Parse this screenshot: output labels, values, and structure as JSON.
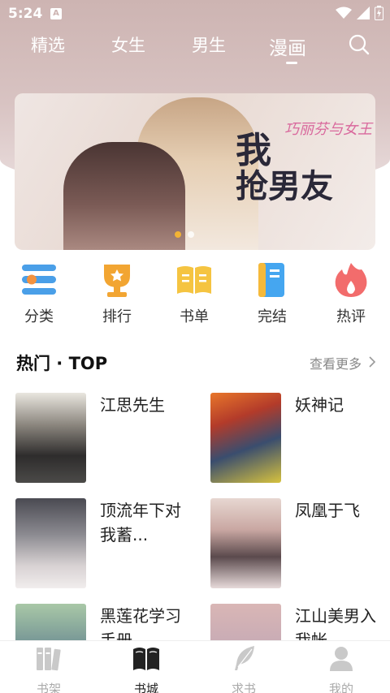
{
  "status_bar": {
    "time": "5:24",
    "notification_letter": "A"
  },
  "top_nav": {
    "tabs": [
      {
        "label": "精选"
      },
      {
        "label": "女生"
      },
      {
        "label": "男生"
      },
      {
        "label": "漫画"
      }
    ],
    "active_tab": "漫画"
  },
  "banner": {
    "title_line1": "我",
    "title_small": "巧丽芬与女王",
    "title_line2": "抢男友",
    "slide_count": 2,
    "active_slide": 1
  },
  "categories": [
    {
      "label": "分类",
      "icon": "classify-icon",
      "color": "#4a9fe8"
    },
    {
      "label": "排行",
      "icon": "trophy-icon",
      "color": "#f2a532"
    },
    {
      "label": "书单",
      "icon": "booklist-icon",
      "color": "#f5c441"
    },
    {
      "label": "完结",
      "icon": "finished-book-icon",
      "color": "#45a6f0"
    },
    {
      "label": "热评",
      "icon": "flame-icon",
      "color": "#f26c6c"
    }
  ],
  "hot_section": {
    "title": "热门 · TOP",
    "more_label": "查看更多"
  },
  "books": [
    {
      "title": "江思先生"
    },
    {
      "title": "妖神记"
    },
    {
      "title": "顶流年下对我蓄..."
    },
    {
      "title": "凤凰于飞"
    },
    {
      "title": "黑莲花学习手册"
    },
    {
      "title": "江山美男入我帐"
    }
  ],
  "bottom_nav": {
    "items": [
      {
        "label": "书架",
        "icon": "bookshelf-icon"
      },
      {
        "label": "书城",
        "icon": "open-book-icon"
      },
      {
        "label": "求书",
        "icon": "feather-icon"
      },
      {
        "label": "我的",
        "icon": "profile-icon"
      }
    ],
    "active": "书城"
  },
  "colors": {
    "accent": "#f2b335",
    "header_tint": "#cdb4b2"
  }
}
